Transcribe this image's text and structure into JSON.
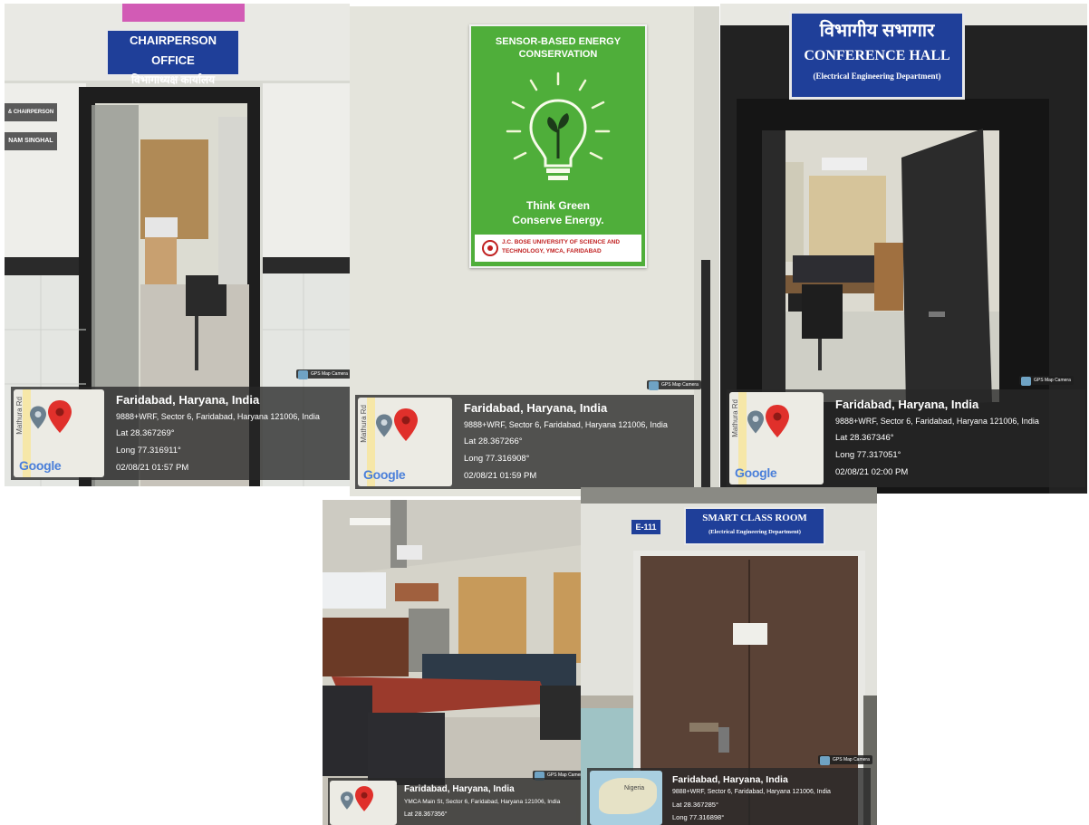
{
  "photos": [
    {
      "signs": {
        "chair_en": "CHAIRPERSON OFFICE",
        "chair_hi": "विभागाध्यक्ष कार्यालय",
        "plate1": "& CHAIRPERSON",
        "plate2": "NAM SINGHAL"
      },
      "gps_tag": "GPS Map Camera",
      "map_road": "Mathura Rd",
      "map_logo": "Google",
      "city": "Faridabad, Haryana, India",
      "address": "9888+WRF, Sector 6, Faridabad, Haryana 121006, India",
      "lat": "Lat 28.367269°",
      "long": "Long 77.316911°",
      "datetime": "02/08/21 01:57 PM"
    },
    {
      "signs": {
        "poster_title": "SENSOR-BASED ENERGY CONSERVATION",
        "poster_slogan1": "Think Green",
        "poster_slogan2": "Conserve Energy.",
        "poster_univ": "J.C. BOSE UNIVERSITY OF SCIENCE AND TECHNOLOGY, YMCA, FARIDABAD"
      },
      "gps_tag": "GPS Map Camera",
      "map_road": "Mathura Rd",
      "map_logo": "Google",
      "city": "Faridabad, Haryana, India",
      "address": "9888+WRF, Sector 6, Faridabad, Haryana 121006, India",
      "lat": "Lat 28.367266°",
      "long": "Long 77.316908°",
      "datetime": "02/08/21 01:59 PM"
    },
    {
      "signs": {
        "hall_hi": "विभागीय सभागार",
        "hall_en": "CONFERENCE HALL",
        "hall_dept": "(Electrical Engineering Department)"
      },
      "gps_tag": "GPS Map Camera",
      "map_road": "Mathura Rd",
      "map_logo": "Google",
      "city": "Faridabad, Haryana, India",
      "address": "9888+WRF, Sector 6, Faridabad, Haryana 121006, India",
      "lat": "Lat 28.367346°",
      "long": "Long 77.317051°",
      "datetime": "02/08/21 02:00 PM"
    },
    {
      "gps_tag": "GPS Map Camera",
      "city": "Faridabad, Haryana, India",
      "address": "YMCA Main St, Sector 6, Faridabad, Haryana 121006, India",
      "lat": "Lat 28.367356°"
    },
    {
      "signs": {
        "room_no": "E-111",
        "smart_en": "SMART CLASS ROOM",
        "smart_dept": "(Electrical Engineering Department)"
      },
      "gps_tag": "GPS Map Camera",
      "map_label": "Nigeria",
      "city": "Faridabad, Haryana, India",
      "address": "9888+WRF, Sector 6, Faridabad, Haryana 121006, India",
      "lat": "Lat 28.367285°",
      "long": "Long 77.316898°"
    }
  ],
  "colors": {
    "sign_blue": "#1f3f99",
    "poster_green": "#4fae3a",
    "door_brown": "#5a4236",
    "overlay_dark": "#282828"
  }
}
